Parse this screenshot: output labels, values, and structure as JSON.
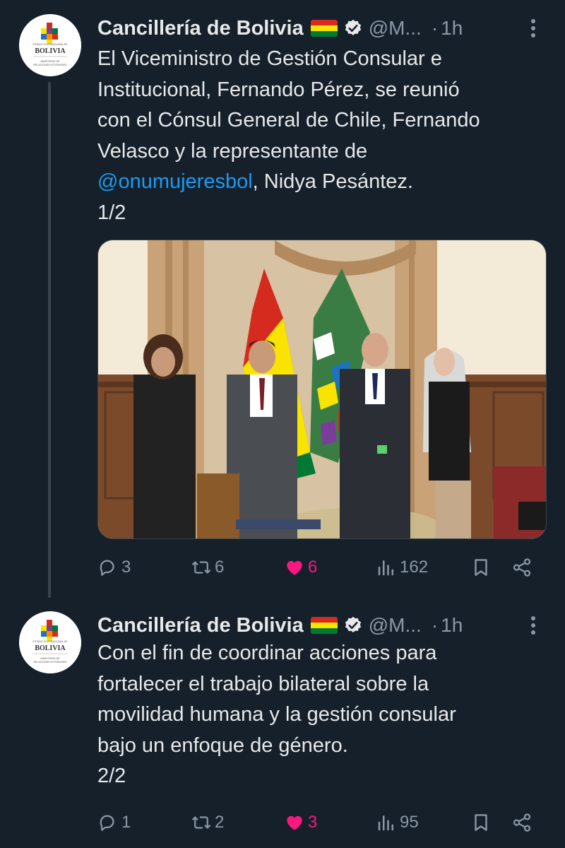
{
  "tweets": [
    {
      "author": "Cancillería de Bolivia",
      "flag": "🇧🇴",
      "handle": "@M...",
      "separator": "·",
      "time": "1h",
      "text_lines": [
        "El Viceministro de Gestión Consular e",
        "Institucional, Fernando Pérez, se reunió",
        "con el Cónsul General de Chile, Fernando",
        "Velasco y la representante de"
      ],
      "mention": "@onumujeresbol",
      "after_mention": ", Nidya Pesántez.",
      "thread_index": "1/2",
      "stats": {
        "replies": "3",
        "retweets": "6",
        "likes": "6",
        "views": "162"
      },
      "liked": true
    },
    {
      "author": "Cancillería de Bolivia",
      "flag": "🇧🇴",
      "handle": "@M...",
      "separator": "·",
      "time": "1h",
      "text_lines": [
        "Con el fin de coordinar acciones para",
        "fortalecer el trabajo bilateral sobre la",
        "movilidad humana y la gestión consular",
        "bajo un enfoque de género."
      ],
      "thread_index": "2/2",
      "stats": {
        "replies": "1",
        "retweets": "2",
        "likes": "3",
        "views": "95"
      },
      "liked": true
    }
  ],
  "avatar": {
    "logo_text": "BOLIVIA",
    "logo_top_text": "ESTADO PLURINACIONAL DE",
    "logo_sub_text": "MINISTERIO DE RELACIONES EXTERIORES"
  },
  "icons": {
    "reply": "reply-icon",
    "retweet": "retweet-icon",
    "like": "heart-icon",
    "views": "views-icon",
    "bookmark": "bookmark-icon",
    "share": "share-icon",
    "more": "more-vertical-icon",
    "verified": "verified-badge-icon"
  },
  "colors": {
    "background": "#15202b",
    "text": "#e7e9ea",
    "secondary": "#8b98a5",
    "link": "#1d9bf0",
    "like": "#f91880"
  }
}
